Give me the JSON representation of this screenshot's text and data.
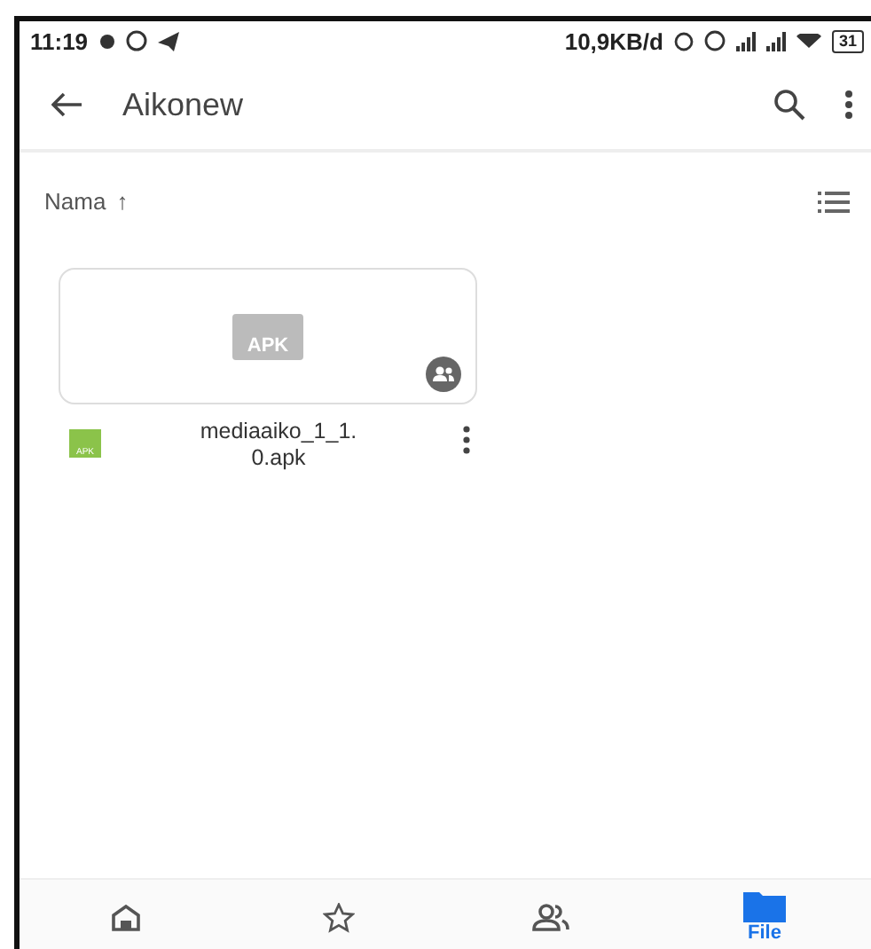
{
  "status_bar": {
    "time": "11:19",
    "speed": "10,9KB/d",
    "battery": "31"
  },
  "toolbar": {
    "title": "Aikonew"
  },
  "sort": {
    "label": "Nama",
    "arrow": "↑"
  },
  "files": [
    {
      "name": "mediaaiko_1_1.\n0.apk",
      "thumb_label": "APK",
      "type_label": "APK",
      "shared": true
    }
  ],
  "bottom_nav": [
    {
      "kind": "home",
      "selected": false
    },
    {
      "kind": "starred",
      "selected": false
    },
    {
      "kind": "shared",
      "selected": false
    },
    {
      "kind": "files",
      "label": "File",
      "selected": true
    }
  ]
}
